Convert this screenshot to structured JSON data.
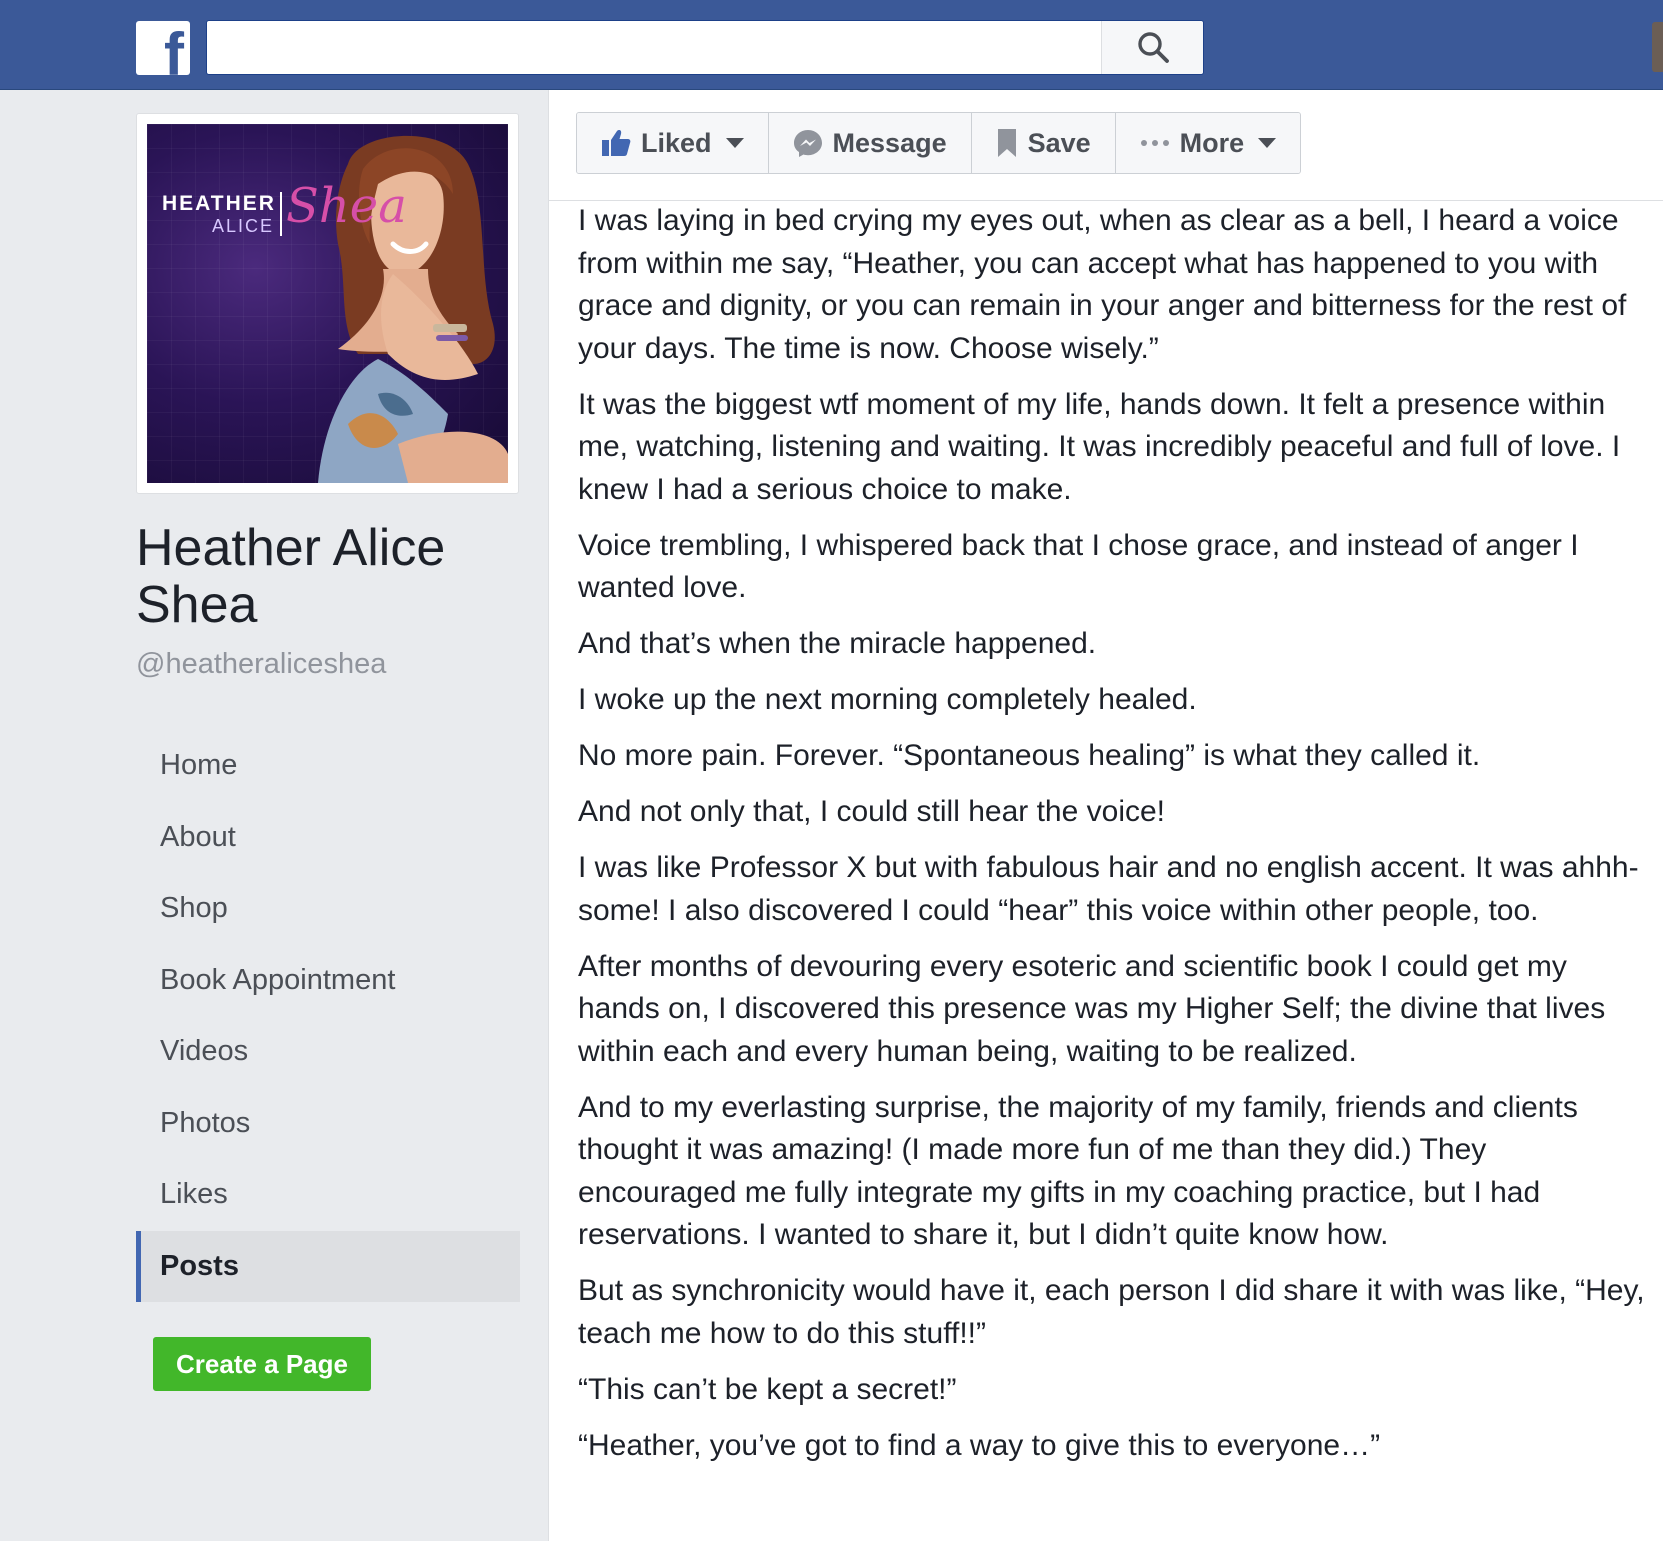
{
  "header": {
    "logo_letter": "f",
    "search": {
      "value": "",
      "placeholder": ""
    },
    "icons": {
      "logo": "facebook-logo-icon",
      "search": "search-icon"
    },
    "colors": {
      "bar": "#3b5998"
    }
  },
  "profile": {
    "picture": {
      "line1": "HEATHER",
      "line2": "ALICE",
      "script": "Shea"
    },
    "name": "Heather Alice Shea",
    "handle": "@heatheraliceshea"
  },
  "sidebar": {
    "items": [
      {
        "label": "Home",
        "active": false
      },
      {
        "label": "About",
        "active": false
      },
      {
        "label": "Shop",
        "active": false
      },
      {
        "label": "Book Appointment",
        "active": false
      },
      {
        "label": "Videos",
        "active": false
      },
      {
        "label": "Photos",
        "active": false
      },
      {
        "label": "Likes",
        "active": false
      },
      {
        "label": "Posts",
        "active": true
      }
    ],
    "create_page_label": "Create a Page",
    "colors": {
      "create_button": "#42b72a",
      "active_indicator": "#4267b2"
    }
  },
  "actions": {
    "liked": {
      "label": "Liked",
      "icon": "thumbs-up-icon"
    },
    "message": {
      "label": "Message",
      "icon": "messenger-icon"
    },
    "save": {
      "label": "Save",
      "icon": "bookmark-icon"
    },
    "more": {
      "label": "More",
      "icon": "ellipsis-icon"
    }
  },
  "post": {
    "paragraphs": [
      "I was laying in bed crying my eyes out, when as clear as a bell, I heard a voice from within me say, “Heather, you can accept what has happened to you with grace and dignity, or you can remain in your anger and bitterness for the rest of your days. The time is now. Choose wisely.”",
      "It was the biggest wtf moment of my life, hands down. It felt a presence within me, watching, listening and waiting. It was incredibly peaceful and full of love. I knew I had a serious choice to make.",
      "Voice trembling, I whispered back that I chose grace, and instead of anger I wanted love.",
      "And that’s when the miracle happened.",
      "I woke up the next morning completely healed.",
      "No more pain. Forever. “Spontaneous healing” is what they called it.",
      "And not only that, I could still hear the voice!",
      "I was like Professor X but with fabulous hair and no english accent. It was ahhh-some! I also discovered I could “hear” this voice within other people, too.",
      "After months of devouring every esoteric and scientific book I could get my hands on, I discovered this presence was my Higher Self; the divine that lives within each and every human being, waiting to be realized.",
      "And to my everlasting surprise, the majority of my family, friends and clients thought it was amazing! (I made more fun of me than they did.) They encouraged me fully integrate my gifts in my coaching practice, but I had reservations. I wanted to share it, but I didn’t quite know how.",
      "But as synchronicity would have it, each person I did share it with was like, “Hey, teach me how to do this stuff!!”",
      "“This can’t be kept a secret!”",
      "“Heather, you’ve got to find a way to give this to everyone…”"
    ]
  }
}
